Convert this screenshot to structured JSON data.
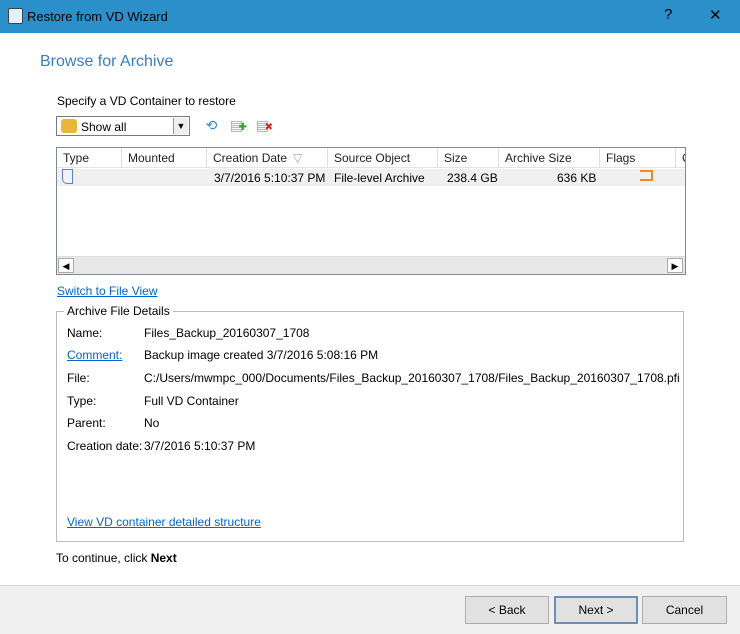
{
  "window": {
    "title": "Restore from VD Wizard",
    "help": "?",
    "close": "✕"
  },
  "page": {
    "heading": "Browse for Archive",
    "specify_label": "Specify a VD Container to restore"
  },
  "filter": {
    "selected": "Show all"
  },
  "toolbar": {
    "icons": [
      "refresh-icon",
      "add-archive-icon",
      "remove-archive-icon"
    ]
  },
  "table": {
    "columns": [
      "Type",
      "Mounted",
      "Creation Date",
      "Source Object",
      "Size",
      "Archive Size",
      "Flags",
      "C"
    ],
    "sort_indicator": "▽",
    "rows": [
      {
        "type_icon": "file-icon",
        "mounted": "",
        "creation_date": "3/7/2016 5:10:37 PM",
        "source_object": "File-level Archive",
        "size": "238.4 GB",
        "archive_size": "636 KB",
        "flags_icon": "flag-icon"
      }
    ]
  },
  "switch_link": "Switch to File View",
  "details": {
    "legend": "Archive File Details",
    "fields": [
      {
        "label": "Name:",
        "value": "Files_Backup_20160307_1708"
      },
      {
        "label": "Comment:",
        "value": "Backup image created 3/7/2016 5:08:16 PM"
      },
      {
        "label": "File:",
        "value": "C:/Users/mwmpc_000/Documents/Files_Backup_20160307_1708/Files_Backup_20160307_1708.pfi"
      },
      {
        "label": "Type:",
        "value": "Full VD Container"
      },
      {
        "label": "Parent:",
        "value": "No"
      },
      {
        "label": "Creation date:",
        "value": "3/7/2016 5:10:37 PM"
      }
    ],
    "structure_link": "View VD container detailed structure"
  },
  "hint": {
    "prefix": "To continue, click ",
    "bold": "Next"
  },
  "buttons": {
    "back": "< Back",
    "next": "Next >",
    "cancel": "Cancel"
  },
  "colors": {
    "titlebar": "#2b8fc9",
    "heading": "#3a7dbf",
    "link": "#0066cc"
  }
}
